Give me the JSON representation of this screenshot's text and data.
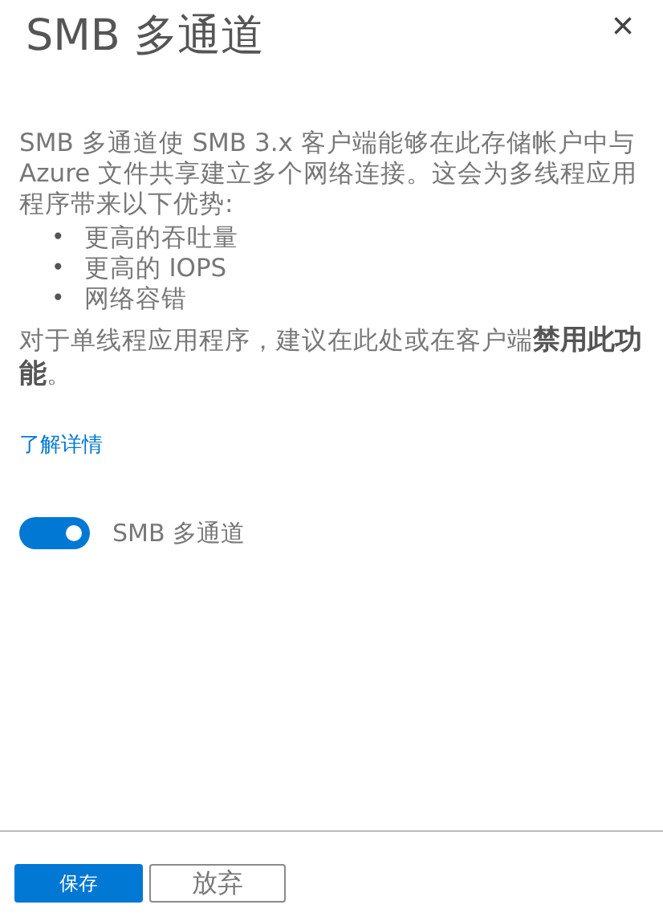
{
  "panel": {
    "title": "SMB 多通道",
    "close": "×"
  },
  "description": "SMB 多通道使 SMB 3.x 客户端能够在此存储帐户中与 Azure 文件共享建立多个网络连接。这会为多线程应用程序带来以下优势:",
  "benefits": [
    {
      "bullet": "•",
      "text": "更高的吞吐量"
    },
    {
      "bullet": "•",
      "text": "更高的 IOPS"
    },
    {
      "bullet": "•",
      "text": "网络容错"
    }
  ],
  "recommendation": "对于单线程应用程序，建议在此处或在客户端**禁用此功能**。",
  "learn_more": "了解详情",
  "toggle": {
    "label": "SMB 多通道",
    "on": true
  },
  "buttons": [
    {
      "label": "保存",
      "kind": "primary"
    },
    {
      "label": "放弃",
      "kind": "secondary"
    }
  ]
}
